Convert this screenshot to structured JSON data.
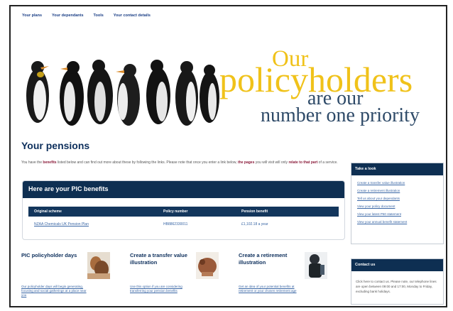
{
  "nav": {
    "items": [
      "Your plans",
      "Your dependants",
      "Tools",
      "Your contact details"
    ]
  },
  "hero": {
    "line1": "Our",
    "line2": "policyholders",
    "line3": "are our",
    "line4": "number one priority"
  },
  "page": {
    "title": "Your pensions",
    "intro_a": "You have the ",
    "intro_b": "benefits",
    "intro_c": " listed below and can find out more about these by following the links. Please note that once you enter a link below, ",
    "intro_d": "the pages",
    "intro_e": " you will visit will only ",
    "intro_f": "relate to that part",
    "intro_g": " of a service."
  },
  "benefits": {
    "heading": "Here are your PIC benefits",
    "columns": [
      "Original scheme",
      "Policy number",
      "Pension benefit"
    ],
    "rows": [
      {
        "scheme": "NZAA Chemicals UK Pension Plan",
        "policy": "HB8862330011",
        "benefit": "£1,102.18 a year"
      }
    ]
  },
  "tiles": [
    {
      "title": "PIC policyholder days",
      "text": "Our policyholder days will begin generating, focusing and social gatherings at a place near you"
    },
    {
      "title": "Create a transfer value illustration",
      "text": "Use this option if you are considering transferring your pension benefits"
    },
    {
      "title": "Create a retirement illustration",
      "text": "Get an idea of your potential benefits at retirement or your chosen retirement age"
    }
  ],
  "sidebar": {
    "take_a_look": "Take a look",
    "links": [
      "Create a transfer value illustration",
      "Create a retirement illustration",
      "Tell us about your dependants",
      "View your policy document",
      "View your latest P60 statement",
      "View your annual benefit statement"
    ],
    "contact_head": "Contact us",
    "contact_text": "Click here to contact us. Please note, our telephone lines are open between 09:00 and 17:00, Monday to Friday, excluding bank holidays."
  },
  "colors": {
    "navy": "#0e2f52",
    "gold": "#f0c21a",
    "slate": "#2e4a68",
    "link": "#3966a5"
  }
}
